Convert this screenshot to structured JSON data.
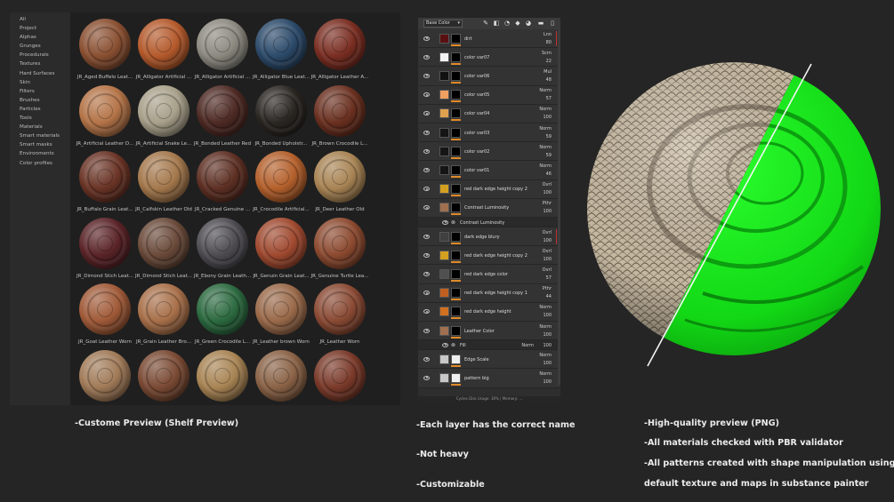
{
  "shelf": {
    "categories": [
      "All",
      "Project",
      "Alphas",
      "Grunges",
      "Procedurals",
      "Textures",
      "Hard Surfaces",
      "Skin",
      "Filters",
      "Brushes",
      "Particles",
      "Tools",
      "Materials",
      "Smart materials",
      "Smart masks",
      "Environments",
      "Color profiles"
    ],
    "items": [
      {
        "label": "JR_Aged Buffelo Leat...",
        "color": "#8a5032"
      },
      {
        "label": "JR_Alligator Artificial ...",
        "color": "#b45a2c"
      },
      {
        "label": "JR_Alligator Artificial ...",
        "color": "#8c8a80"
      },
      {
        "label": "JR_Alligator Blue Leat...",
        "color": "#2c4a6a"
      },
      {
        "label": "JR_Alligator Leather A...",
        "color": "#7a2e22"
      },
      {
        "label": "JR_Artificial Leather D...",
        "color": "#b47448"
      },
      {
        "label": "JR_Artificial Snake Le...",
        "color": "#a8a08a"
      },
      {
        "label": "JR_Bonded Leather Red",
        "color": "#4e2a24"
      },
      {
        "label": "JR_Bonded Upholstr...",
        "color": "#2a2622"
      },
      {
        "label": "JR_Brown Crocodile L...",
        "color": "#6a3020"
      },
      {
        "label": "JR_Buffalo Grain Leat...",
        "color": "#6a3426"
      },
      {
        "label": "JR_Calfskin Leather Old",
        "color": "#a4784c"
      },
      {
        "label": "JR_Cracked Genuine ...",
        "color": "#5e3024"
      },
      {
        "label": "JR_Crocodile Artificial...",
        "color": "#b4602c"
      },
      {
        "label": "JR_Deer Leather Old",
        "color": "#a88454"
      },
      {
        "label": "JR_Dimond Stich Leat...",
        "color": "#5a2428"
      },
      {
        "label": "JR_Dimond Stich Leat...",
        "color": "#6a4a3a"
      },
      {
        "label": "JR_Ebony Grain Leath...",
        "color": "#4e4c52"
      },
      {
        "label": "JR_Genuin Grain Leat...",
        "color": "#a04a30"
      },
      {
        "label": "JR_Genuine Turtle Lea...",
        "color": "#8c4a30"
      },
      {
        "label": "JR_Goat Leather Worn",
        "color": "#a05a38"
      },
      {
        "label": "JR_Grain Leather Bro...",
        "color": "#a8704a"
      },
      {
        "label": "JR_Green Crocodile L...",
        "color": "#2c6a40"
      },
      {
        "label": "JR_Leather brown Worn",
        "color": "#9a6a4a"
      },
      {
        "label": "JR_Leather Worn",
        "color": "#8a4a34"
      },
      {
        "label": "",
        "color": "#a07a58"
      },
      {
        "label": "",
        "color": "#7a4a34"
      },
      {
        "label": "",
        "color": "#a88454"
      },
      {
        "label": "",
        "color": "#8a6246"
      },
      {
        "label": "",
        "color": "#7a3a2a"
      }
    ]
  },
  "layers": {
    "blend_mode": "Base Color",
    "status": "Cycles Disk Usage: 30% | Memory: ...",
    "rows": [
      {
        "name": "dirt",
        "blend": "Lnn",
        "opacity": "80",
        "thumb": "#5a1010",
        "mask": "#000000",
        "red": true
      },
      {
        "name": "color var07",
        "blend": "Scrn",
        "opacity": "22",
        "thumb": "#f2f2f2",
        "mask": "#000000"
      },
      {
        "name": "color var06",
        "blend": "Mul",
        "opacity": "48",
        "thumb": "#111111",
        "mask": "#000000"
      },
      {
        "name": "color var05",
        "blend": "Norm",
        "opacity": "57",
        "thumb": "#f0a060",
        "mask": "#000000"
      },
      {
        "name": "color var04",
        "blend": "Norm",
        "opacity": "100",
        "thumb": "#e0a050",
        "mask": "#000000"
      },
      {
        "name": "color var03",
        "blend": "Norm",
        "opacity": "59",
        "thumb": "#151515",
        "mask": "#000000"
      },
      {
        "name": "color var02",
        "blend": "Norm",
        "opacity": "59",
        "thumb": "#151515",
        "mask": "#000000"
      },
      {
        "name": "color var01",
        "blend": "Norm",
        "opacity": "46",
        "thumb": "#151515",
        "mask": "#000000"
      },
      {
        "name": "red dark edge height copy 2",
        "blend": "Ovrl",
        "opacity": "100",
        "thumb": "#d4a020",
        "mask": "#000000"
      },
      {
        "name": "Contrast Luminosity",
        "blend": "Pthr",
        "opacity": "100",
        "thumb": "#a07050",
        "mask": "#000000"
      },
      {
        "name": "Contrast Luminosity",
        "sub": true
      },
      {
        "name": "dark edge blury",
        "blend": "Ovrl",
        "opacity": "100",
        "thumb": "#404040",
        "mask": "#000000",
        "red": true
      },
      {
        "name": "red dark edge height copy 2",
        "blend": "Ovrl",
        "opacity": "100",
        "thumb": "#d4a020",
        "mask": "#000000"
      },
      {
        "name": "red dark edge color",
        "blend": "Ovrl",
        "opacity": "57",
        "thumb": "#505050",
        "mask": "#000000"
      },
      {
        "name": "red dark edge height copy 1",
        "blend": "Pthr",
        "opacity": "44",
        "thumb": "#c06020",
        "mask": "#000000"
      },
      {
        "name": "red dark edge height",
        "blend": "Norm",
        "opacity": "100",
        "thumb": "#d07020",
        "mask": "#000000"
      },
      {
        "name": "Leather Color",
        "blend": "Norm",
        "opacity": "100",
        "thumb": "#a07050",
        "mask": "#000000"
      },
      {
        "name": "Fill",
        "blend": "Norm",
        "opacity": "100",
        "sub": true
      },
      {
        "name": "Edge Scale",
        "blend": "Norm",
        "opacity": "100",
        "thumb": "#c8c8c8",
        "mask": "#f0f0f0"
      },
      {
        "name": "pattern big",
        "blend": "Norm",
        "opacity": "100",
        "thumb": "#c8c8c8",
        "mask": "#f0f0f0"
      }
    ]
  },
  "captions": {
    "shelf": "-Custome Preview (Shelf Preview)",
    "layers_1": "-Each layer has the correct name",
    "layers_2": "-Not heavy",
    "layers_3": "-Customizable",
    "preview_1": "-High-quality preview (PNG)",
    "preview_2": "-All materials checked with PBR validator",
    "preview_3": "-All patterns created with shape manipulation using",
    "preview_4": "default texture and maps in substance painter"
  },
  "colors": {
    "background": "#252525",
    "accent_orange": "#e08a28",
    "preview_green": "#17e01b",
    "snake_skin": "#cdbfa8"
  }
}
